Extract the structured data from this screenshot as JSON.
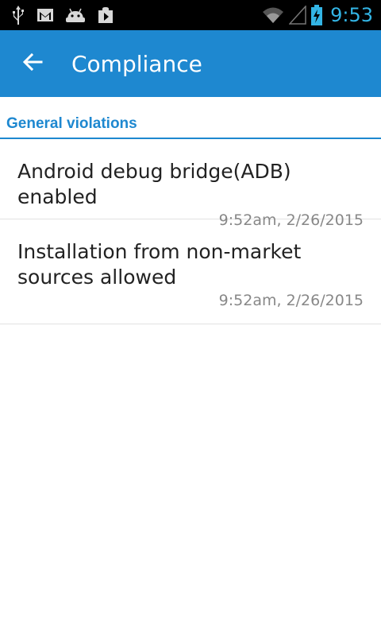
{
  "status_bar": {
    "time": "9:53",
    "icons": [
      "usb-icon",
      "gmail-icon",
      "android-icon",
      "play-store-icon",
      "wifi-icon",
      "no-signal-icon",
      "battery-charging-icon"
    ],
    "time_color": "#33b5e5"
  },
  "app_bar": {
    "title": "Compliance",
    "back_icon": "back-arrow-icon",
    "color": "#1e88d0"
  },
  "section": {
    "title": "General violations"
  },
  "violations": [
    {
      "title": "Android debug bridge(ADB) enabled",
      "time": "9:52am, 2/26/2015"
    },
    {
      "title": "Installation from non-market sources allowed",
      "time": "9:52am, 2/26/2015"
    }
  ]
}
